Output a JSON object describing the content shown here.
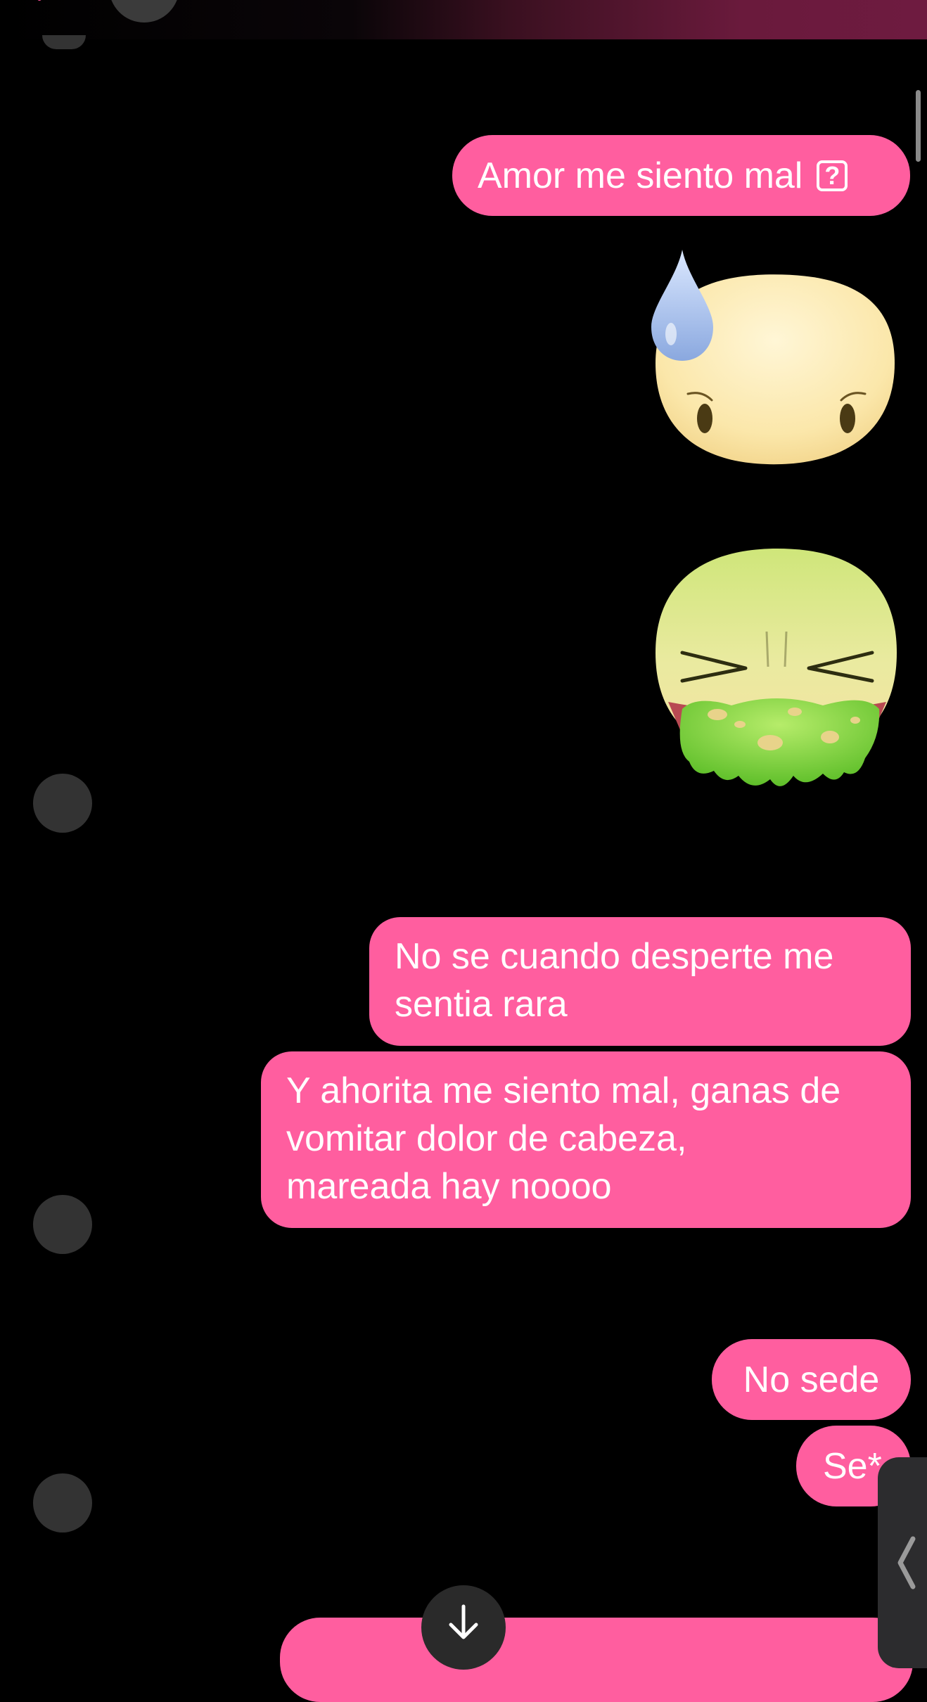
{
  "header": {
    "back_icon": "chevron-left-icon",
    "accent_color": "#ff4f9a",
    "gradient_end": "#6e1b40"
  },
  "colors": {
    "bubble": "#ff5e9f",
    "background": "#000000",
    "avatar_placeholder": "#333333"
  },
  "messages": [
    {
      "type": "text",
      "text": "Amor me siento mal",
      "suffix_icon": "unsupported-character-icon",
      "suffix_glyph": "?"
    },
    {
      "type": "sticker",
      "emoji": "sweating-worried-face-emoji"
    },
    {
      "type": "sticker",
      "emoji": "vomiting-face-emoji"
    },
    {
      "type": "text",
      "lines": [
        "No se cuando desperte me",
        "sentia rara"
      ]
    },
    {
      "type": "text",
      "lines": [
        "Y ahorita me siento mal, ganas de",
        "vomitar dolor de cabeza,",
        "mareada hay noooo"
      ]
    },
    {
      "type": "text",
      "text": "No sede"
    },
    {
      "type": "text",
      "text": "Se*"
    }
  ],
  "partial_message": {
    "type": "text",
    "state": "partially-visible-cut-off"
  },
  "controls": {
    "scroll_down_icon": "arrow-down-icon",
    "side_handle_icon": "chevron-left-icon"
  }
}
